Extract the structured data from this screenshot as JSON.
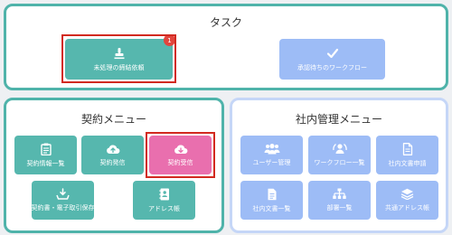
{
  "task": {
    "title": "タスク",
    "items": [
      {
        "label": "未処理の締結依頼",
        "badge": "1",
        "icon": "stamp-icon"
      },
      {
        "label": "承認待ちのワークフロー",
        "icon": "check-icon"
      }
    ]
  },
  "contract_menu": {
    "title": "契約メニュー",
    "items": [
      {
        "label": "契約情報一覧",
        "icon": "clipboard-icon"
      },
      {
        "label": "契約発信",
        "icon": "cloud-upload-icon"
      },
      {
        "label": "契約受信",
        "icon": "cloud-download-icon"
      },
      {
        "label": "契約書・電子取引保存",
        "icon": "tray-download-icon"
      },
      {
        "label": "アドレス帳",
        "icon": "address-book-icon"
      }
    ]
  },
  "internal_menu": {
    "title": "社内管理メニュー",
    "items": [
      {
        "label": "ユーザー管理",
        "icon": "users-icon"
      },
      {
        "label": "ワークフロー一覧",
        "icon": "workflow-icon"
      },
      {
        "label": "社内文書申請",
        "icon": "document-icon"
      },
      {
        "label": "社内文書一覧",
        "icon": "document-list-icon"
      },
      {
        "label": "部署一覧",
        "icon": "org-chart-icon"
      },
      {
        "label": "共通アドレス帳",
        "icon": "layers-icon"
      }
    ]
  },
  "colors": {
    "teal": "#56b7ae",
    "blue": "#9dbcf6",
    "pink": "#e96fae",
    "highlight": "#d22a20"
  }
}
